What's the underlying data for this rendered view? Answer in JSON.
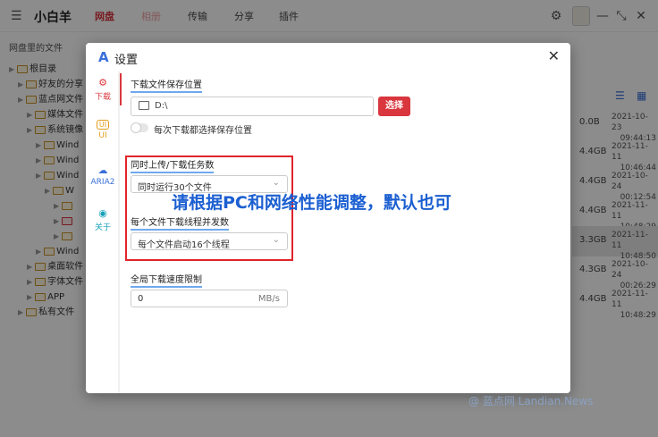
{
  "app": {
    "title": "小白羊",
    "nav": [
      "网盘",
      "相册",
      "传输",
      "分享",
      "插件"
    ]
  },
  "left_panel": {
    "title": "网盘里的文件",
    "tree": [
      {
        "label": "根目录",
        "indent": 0
      },
      {
        "label": "好友的分享",
        "indent": 1
      },
      {
        "label": "蓝点网文件",
        "indent": 1
      },
      {
        "label": "媒体文件",
        "indent": 2
      },
      {
        "label": "系统镜像",
        "indent": 2
      },
      {
        "label": "Wind",
        "indent": 3
      },
      {
        "label": "Wind",
        "indent": 3
      },
      {
        "label": "Wind",
        "indent": 3
      },
      {
        "label": "W",
        "indent": 4
      },
      {
        "label": "",
        "indent": 5
      },
      {
        "label": "",
        "indent": 5
      },
      {
        "label": "",
        "indent": 5
      },
      {
        "label": "Wind",
        "indent": 3
      },
      {
        "label": "桌面软件",
        "indent": 2
      },
      {
        "label": "字体文件",
        "indent": 2
      },
      {
        "label": "APP",
        "indent": 2
      },
      {
        "label": "私有文件",
        "indent": 1
      }
    ]
  },
  "right_panel": {
    "rows": [
      {
        "size": "0.0B",
        "date": "2021-10-23",
        "time": "09:44:13"
      },
      {
        "size": "4.4GB",
        "date": "2021-11-11",
        "time": "10:46:44"
      },
      {
        "size": "4.4GB",
        "date": "2021-10-24",
        "time": "00:12:54"
      },
      {
        "size": "4.4GB",
        "date": "2021-11-11",
        "time": "10:48:29"
      },
      {
        "size": "3.3GB",
        "date": "2021-11-11",
        "time": "10:48:50"
      },
      {
        "size": "4.3GB",
        "date": "2021-10-24",
        "time": "00:26:29"
      },
      {
        "size": "4.4GB",
        "date": "2021-11-11",
        "time": "10:48:29"
      }
    ]
  },
  "dialog": {
    "logo": "A",
    "title": "设置",
    "close": "✕",
    "sidebar": [
      {
        "label": "下载",
        "icon": "⚙"
      },
      {
        "label": "UI",
        "icon": "UI"
      },
      {
        "label": "ARIA2",
        "icon": "☁"
      },
      {
        "label": "关于",
        "icon": "◉"
      }
    ],
    "download_location": {
      "label": "下载文件保存位置",
      "path": "D:\\",
      "select_button": "选择",
      "toggle_label": "每次下载都选择保存位置"
    },
    "concurrent_tasks": {
      "label": "同时上传/下载任务数",
      "value": "同时运行30个文件"
    },
    "threads": {
      "label": "每个文件下载线程并发数",
      "value": "每个文件启动16个线程"
    },
    "speed_limit": {
      "label": "全局下载速度限制",
      "value": "0",
      "unit": "MB/s"
    },
    "annotation": "请根据PC和网络性能调整，默认也可"
  },
  "watermark": "@ 蓝点网 Landian.News"
}
